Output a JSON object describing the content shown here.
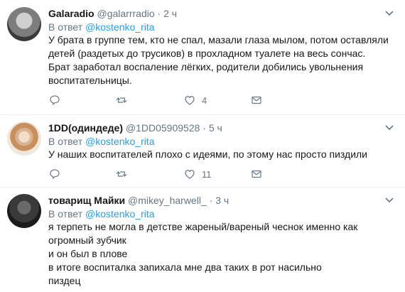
{
  "tweets": [
    {
      "name": "Galaradio",
      "handle": "@galarrradio",
      "time": "2 ч",
      "reply_prefix": "В ответ",
      "reply_mention": "@kostenko_rita",
      "text": "У брата в группе тем, кто не спал, мазали глаза мылом, потом оставляли детей (раздетых до трусиков) в прохладном туалете на весь сончас. Брат заработал воспаление лёгких, родители добились увольнения воспитательницы.",
      "likes": "4"
    },
    {
      "name": "1DD(одиндеде)",
      "handle": "@1DD05909528",
      "time": "5 ч",
      "reply_prefix": "В ответ",
      "reply_mention": "@kostenko_rita",
      "text": "У наших воспитателей плохо с идеями, по этому нас просто пиздили",
      "likes": "11"
    },
    {
      "name": "товарищ Майки",
      "handle": "@mikey_harwell_",
      "time": "3 ч",
      "reply_prefix": "В ответ",
      "reply_mention": "@kostenko_rita",
      "text_lines": [
        "я терпеть не могла в детстве жареный/вареный чеснок именно как огромный зубчик",
        "и он был в плове",
        "в итоге воспиталка запихала мне два таких в рот насильно",
        "пиздец"
      ]
    }
  ],
  "colors": {
    "accent": "#1da1f2",
    "muted": "#657786",
    "text": "#14171a",
    "divider": "#e6ecf0"
  },
  "icons": [
    "reply-icon",
    "retweet-icon",
    "like-icon",
    "mail-icon",
    "chevron-down-icon"
  ]
}
